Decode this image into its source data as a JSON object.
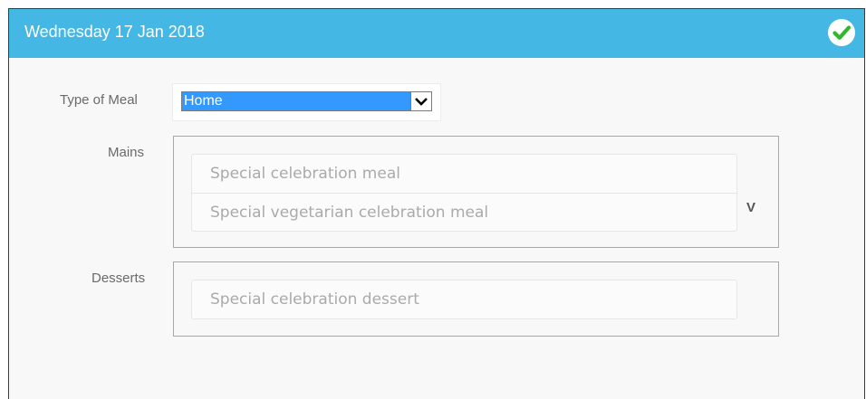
{
  "header": {
    "title": "Wednesday 17 Jan 2018",
    "status_icon": "check-circle-icon",
    "status_color": "#2eb82e"
  },
  "meal_type": {
    "label": "Type of Meal",
    "selected": "Home"
  },
  "mains": {
    "label": "Mains",
    "items": [
      "Special celebration meal",
      "Special vegetarian celebration meal"
    ],
    "marker": "V"
  },
  "desserts": {
    "label": "Desserts",
    "items": [
      "Special celebration dessert"
    ]
  },
  "colors": {
    "header_bg": "#45b7e5",
    "selection": "#3399ff"
  }
}
